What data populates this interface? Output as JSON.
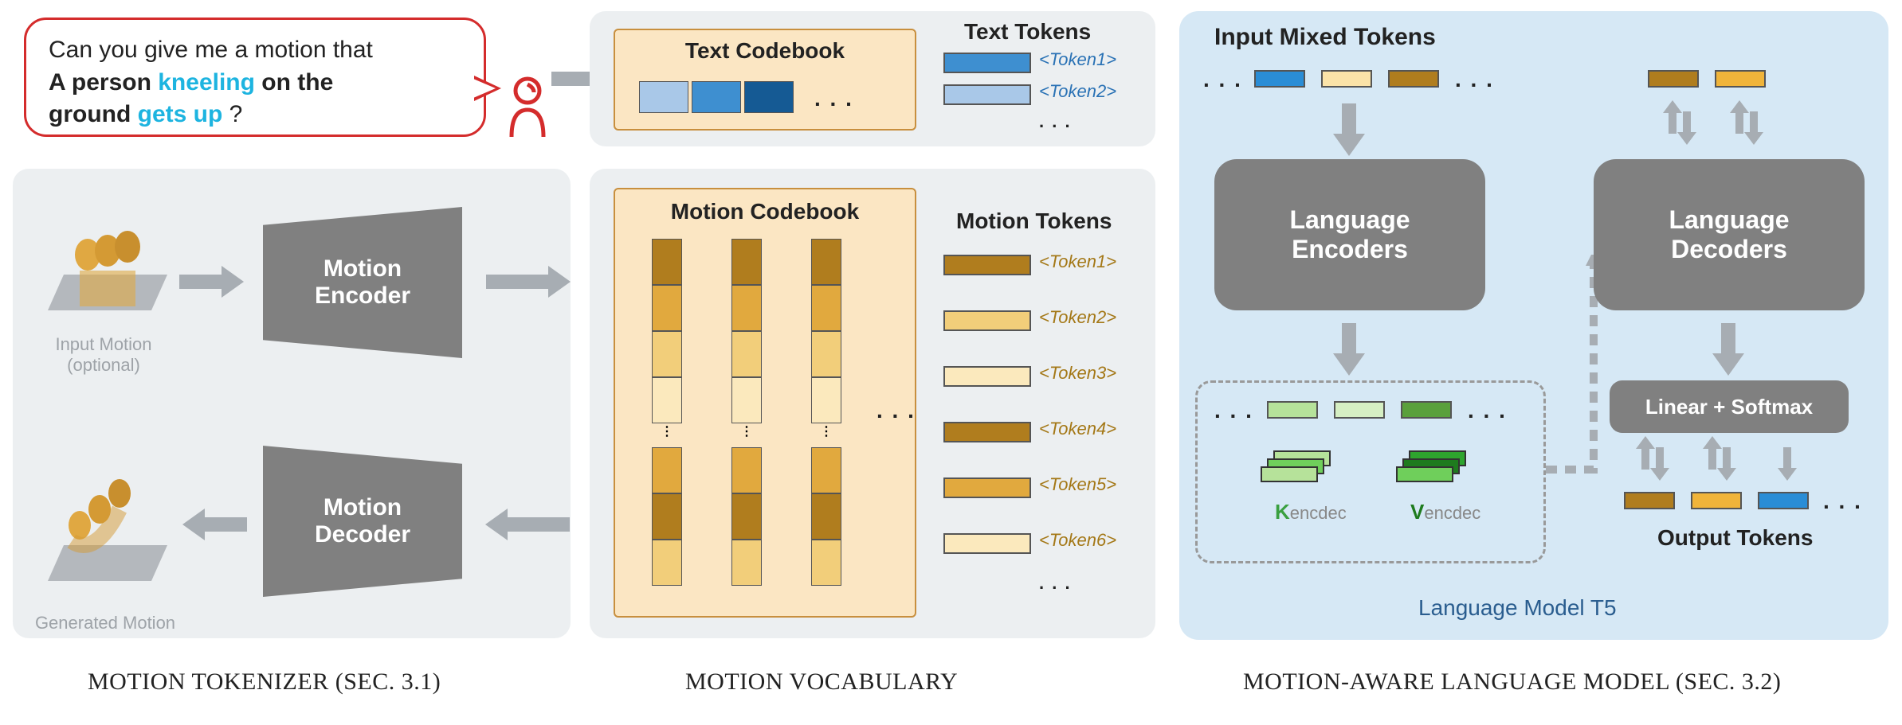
{
  "speech": {
    "prefix": "Can you give me a motion that",
    "bold1": "A person",
    "kw1": "kneeling",
    "bold2": "on the",
    "bold3": "ground",
    "kw2": "gets up",
    "suffix": "?"
  },
  "left": {
    "encoder": "Motion\nEncoder",
    "decoder": "Motion\nDecoder",
    "input_label": "Input Motion\n(optional)",
    "output_label": "Generated Motion",
    "caption": "MOTION TOKENIZER (SEC. 3.1)"
  },
  "mid": {
    "text_codebook": "Text Codebook",
    "motion_codebook": "Motion Codebook",
    "text_tokens_title": "Text Tokens",
    "motion_tokens_title": "Motion Tokens",
    "text_tokens": [
      "<Token1>",
      "<Token2>"
    ],
    "motion_tokens": [
      "<Token1>",
      "<Token2>",
      "<Token3>",
      "<Token4>",
      "<Token5>",
      "<Token6>"
    ],
    "caption": "MOTION VOCABULARY"
  },
  "right": {
    "input_title": "Input Mixed Tokens",
    "encoders": "Language\nEncoders",
    "decoders": "Language\nDecoders",
    "linear": "Linear + Softmax",
    "k_label": "K",
    "v_label": "V",
    "kv_sub": "encdec",
    "output_title": "Output Tokens",
    "lm_caption": "Language Model T5",
    "caption": "MOTION-AWARE LANGUAGE MODEL (SEC. 3.2)"
  },
  "colors": {
    "text_tokens": [
      "#3e8fd0",
      "#a9c8e8"
    ],
    "motion_tokens": [
      "#b07d1e",
      "#f2ce7a",
      "#fbe9bd",
      "#b07d1e",
      "#e1a93e",
      "#fbe9bd"
    ]
  }
}
